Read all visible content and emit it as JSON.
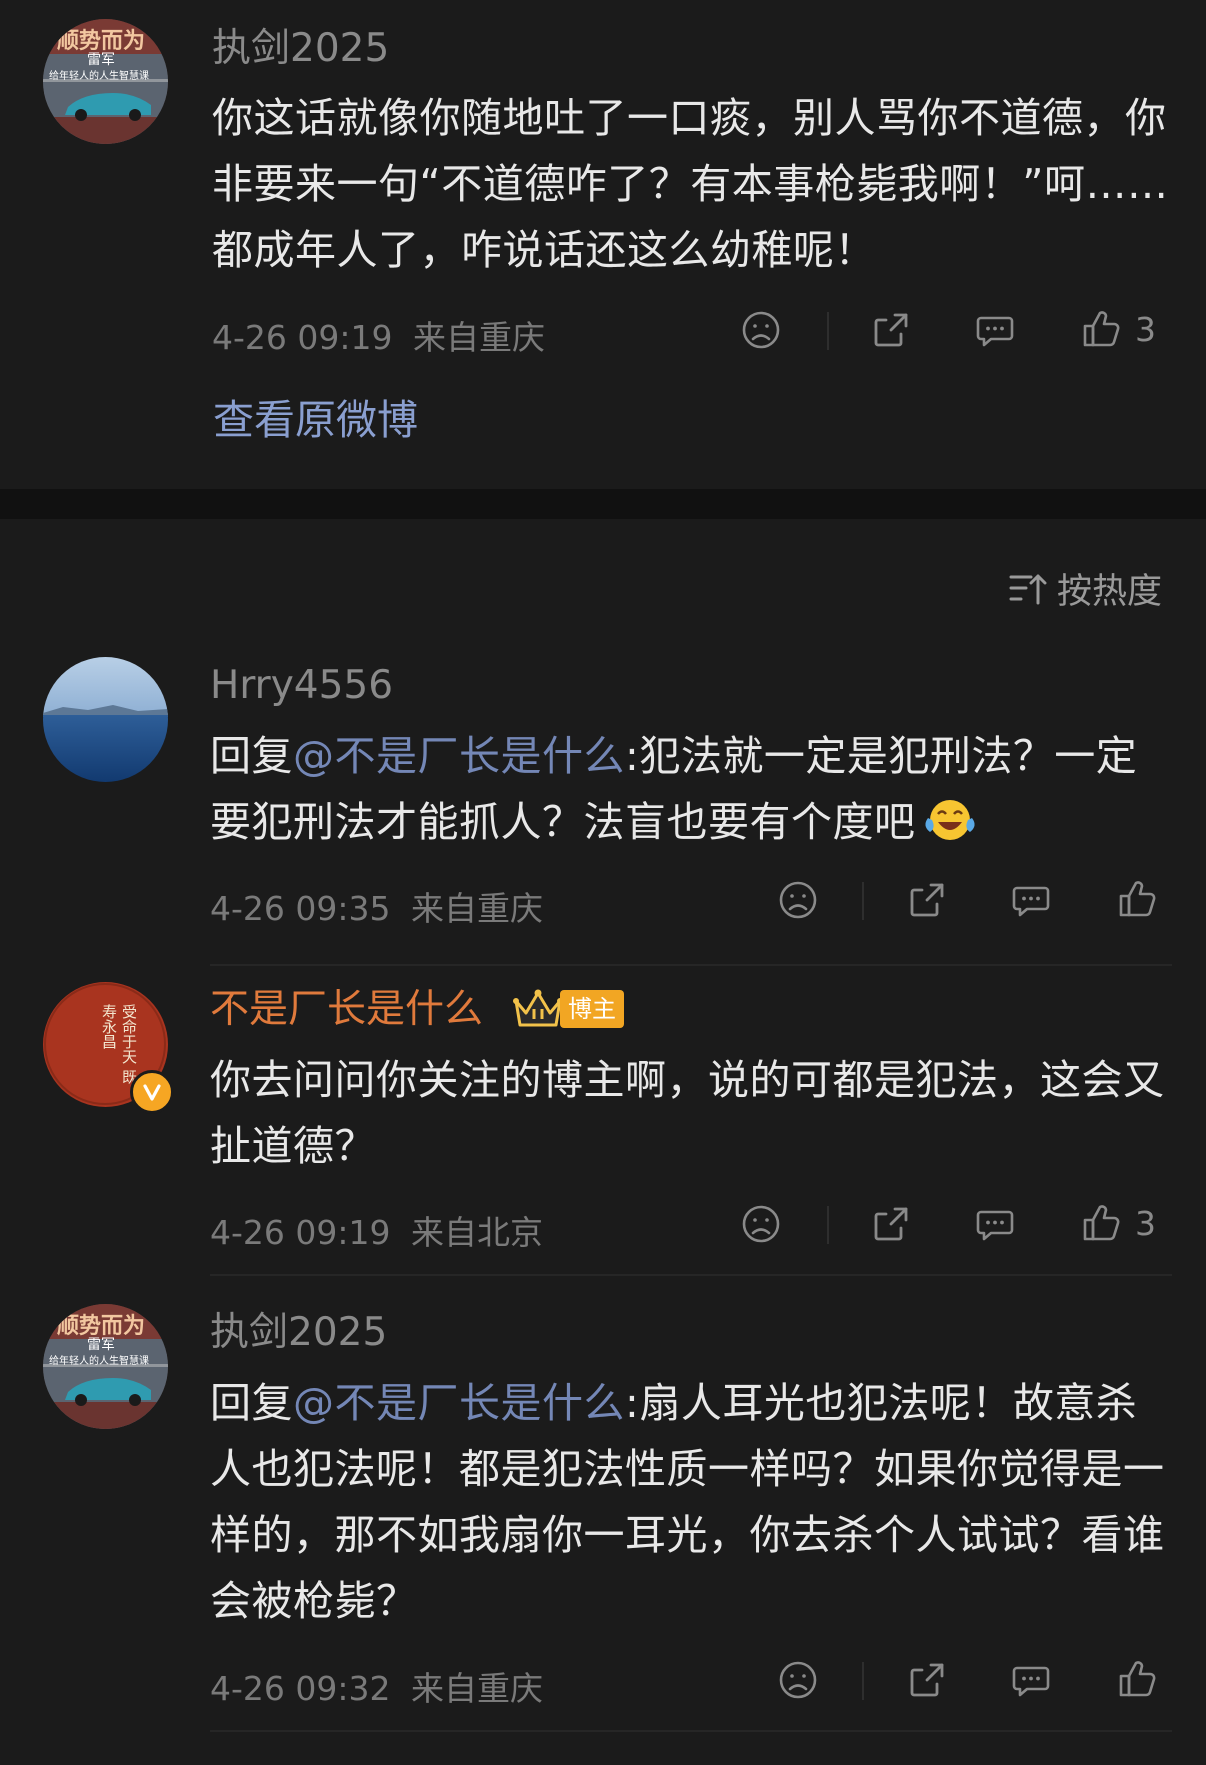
{
  "top_comment": {
    "username": "执剑2025",
    "text": "你这话就像你随地吐了一口痰，别人骂你不道德，你非要来一句“不道德咋了？有本事枪毙我啊！”呵……都成年人了，咋说话还这么幼稚呢！",
    "timestamp": "4-26 09:19",
    "location": "来自重庆",
    "like_count": "3",
    "view_original": "查看原微博"
  },
  "sort": {
    "label": "按热度"
  },
  "replies": [
    {
      "username": "Hrry4556",
      "reply_prefix": "回复",
      "mention": "@不是厂长是什么",
      "text": ":犯法就一定是犯刑法？一定要犯刑法才能抓人？法盲也要有个度吧",
      "timestamp": "4-26 09:35",
      "location": "来自重庆",
      "like_count": ""
    },
    {
      "username": "不是厂长是什么",
      "badge": "博主",
      "text": "你去问问你关注的博主啊，说的可都是犯法，这会又扯道德？",
      "timestamp": "4-26 09:19",
      "location": "来自北京",
      "like_count": "3"
    },
    {
      "username": "执剑2025",
      "reply_prefix": "回复",
      "mention": "@不是厂长是什么",
      "text": ":扇人耳光也犯法呢！故意杀人也犯法呢！都是犯法性质一样吗？如果你觉得是一样的，那不如我扇你一耳光，你去杀个人试试？看谁会被枪毙？",
      "timestamp": "4-26 09:32",
      "location": "来自重庆",
      "like_count": ""
    }
  ],
  "avatar_text": {
    "banner_top": "顺势而为",
    "name": "雷军",
    "subtitle": "给年轻人的人生智慧课",
    "seal": "受命于天 既寿永昌"
  },
  "icons": [
    "sad-face-icon",
    "share-icon",
    "comment-icon",
    "thumbs-up-icon",
    "sort-icon",
    "crown-icon",
    "verified-v-icon",
    "laughing-tears-emoji"
  ],
  "colors": {
    "background": "#1b1b1b",
    "mention": "#7487b6",
    "orange_name": "#e07a3c",
    "badge": "#f2a623"
  }
}
